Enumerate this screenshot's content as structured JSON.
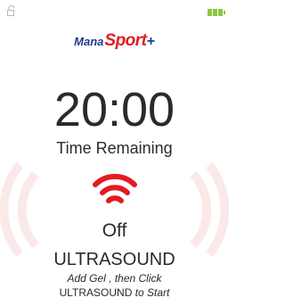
{
  "status_bar": {
    "lock_icon": "lock-icon",
    "battery_icon": "battery-icon",
    "battery_color": "#8dc63f"
  },
  "logo": {
    "part1": "Mana",
    "part2": "Sport",
    "part3": "+",
    "color_primary": "#1b3a8c",
    "color_accent": "#e31b23"
  },
  "timer": {
    "value": "20:00",
    "label": "Time Remaining"
  },
  "ultrasound": {
    "signal_icon": "wireless-signal-icon",
    "signal_color": "#e31b23",
    "state": "Off",
    "button_label": "ULTRASOUND",
    "instruction_line1": "Add Gel , then Click",
    "instruction_line2_bold": "ULTRASOUND",
    "instruction_line2_italic": " to Start"
  }
}
